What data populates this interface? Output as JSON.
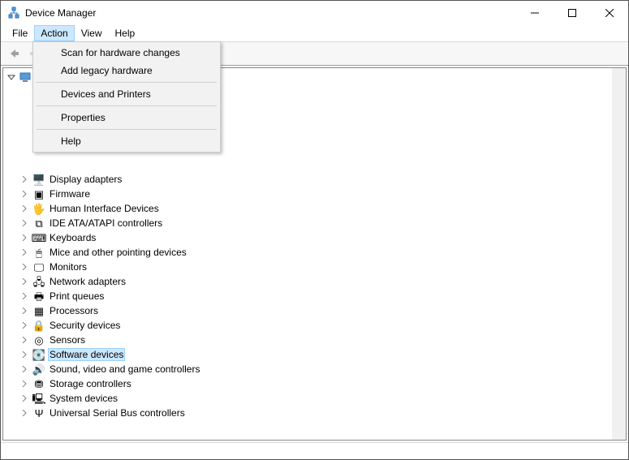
{
  "title": "Device Manager",
  "menubar": [
    "File",
    "Action",
    "View",
    "Help"
  ],
  "active_menu_index": 1,
  "dropdown": {
    "groups": [
      [
        "Scan for hardware changes",
        "Add legacy hardware"
      ],
      [
        "Devices and Printers"
      ],
      [
        "Properties"
      ],
      [
        "Help"
      ]
    ]
  },
  "tree": {
    "root": {
      "label": "",
      "icon": "pc-icon",
      "expanded": true
    },
    "categories": [
      {
        "label": "Display adapters",
        "icon": "🖥️"
      },
      {
        "label": "Firmware",
        "icon": "▣"
      },
      {
        "label": "Human Interface Devices",
        "icon": "🖐"
      },
      {
        "label": "IDE ATA/ATAPI controllers",
        "icon": "⧉"
      },
      {
        "label": "Keyboards",
        "icon": "⌨"
      },
      {
        "label": "Mice and other pointing devices",
        "icon": "🖱"
      },
      {
        "label": "Monitors",
        "icon": "🖵"
      },
      {
        "label": "Network adapters",
        "icon": "🖧"
      },
      {
        "label": "Print queues",
        "icon": "🖶"
      },
      {
        "label": "Processors",
        "icon": "▦"
      },
      {
        "label": "Security devices",
        "icon": "🔒"
      },
      {
        "label": "Sensors",
        "icon": "◎"
      },
      {
        "label": "Software devices",
        "icon": "💽",
        "selected": true
      },
      {
        "label": "Sound, video and game controllers",
        "icon": "🔊"
      },
      {
        "label": "Storage controllers",
        "icon": "⛃"
      },
      {
        "label": "System devices",
        "icon": "🖳"
      },
      {
        "label": "Universal Serial Bus controllers",
        "icon": "Ψ"
      }
    ],
    "hidden_above_count": 6
  }
}
